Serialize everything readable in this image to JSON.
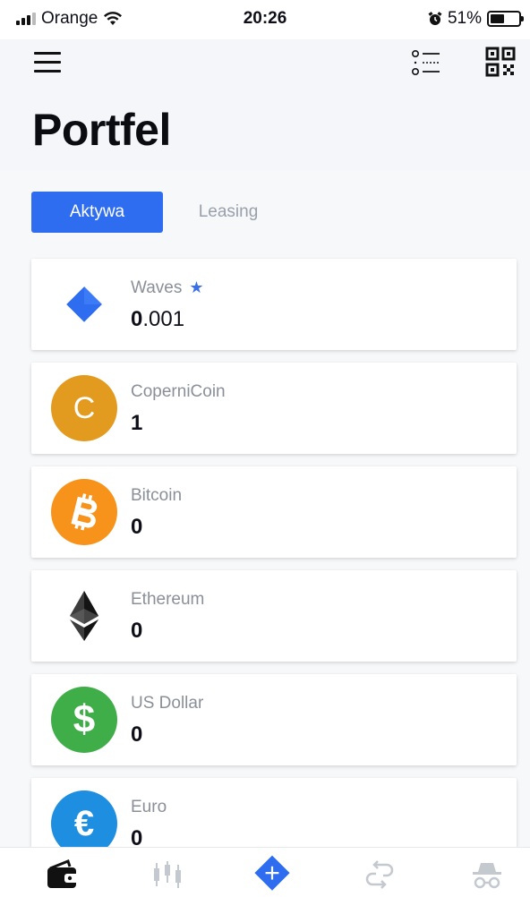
{
  "status_bar": {
    "carrier": "Orange",
    "time": "20:26",
    "battery_percent": "51%",
    "battery_level": 0.51
  },
  "header": {
    "title": "Portfel"
  },
  "tabs": [
    {
      "label": "Aktywa",
      "active": true
    },
    {
      "label": "Leasing",
      "active": false
    }
  ],
  "assets": [
    {
      "name": "Waves",
      "balance_int": "0",
      "balance_dec": ".001",
      "favorite": true,
      "icon": "waves-icon",
      "color": "#2e6cf0"
    },
    {
      "name": "CoperniCoin",
      "balance_int": "1",
      "balance_dec": "",
      "icon": "copernicoin-icon",
      "glyph": "C",
      "color": "#e39b1f"
    },
    {
      "name": "Bitcoin",
      "balance_int": "0",
      "balance_dec": "",
      "icon": "bitcoin-icon",
      "color": "#f7931a"
    },
    {
      "name": "Ethereum",
      "balance_int": "0",
      "balance_dec": "",
      "icon": "ethereum-icon",
      "color": "#3c3c3d"
    },
    {
      "name": "US Dollar",
      "balance_int": "0",
      "balance_dec": "",
      "icon": "us-dollar-icon",
      "glyph": "$",
      "color": "#3fae49"
    },
    {
      "name": "Euro",
      "balance_int": "0",
      "balance_dec": "",
      "icon": "euro-icon",
      "glyph": "€",
      "color": "#1e8fe0"
    }
  ],
  "bottom_nav": [
    {
      "name": "wallet-icon",
      "active": true
    },
    {
      "name": "dex-chart-icon",
      "active": false
    },
    {
      "name": "add-icon",
      "active": false,
      "color": "#2e6cf0"
    },
    {
      "name": "transfer-icon",
      "active": false
    },
    {
      "name": "anonymous-icon",
      "active": false
    }
  ]
}
